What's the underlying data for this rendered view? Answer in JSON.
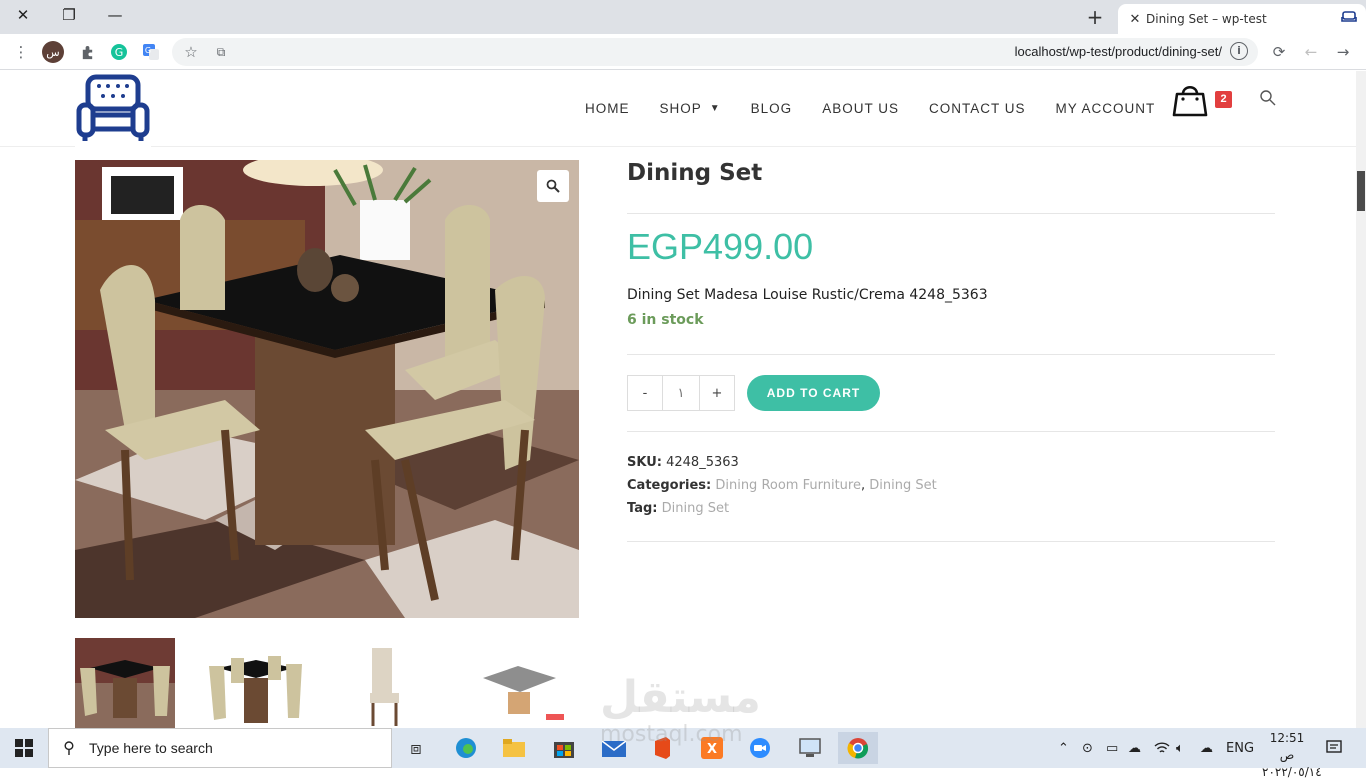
{
  "browser": {
    "tab_title": "Dining Set – wp-test",
    "url": "localhost/wp-test/product/dining-set/",
    "profile_initial": "س"
  },
  "site": {
    "nav": [
      "HOME",
      "SHOP",
      "BLOG",
      "ABOUT US",
      "CONTACT US",
      "MY ACCOUNT"
    ],
    "cart_count": "2",
    "accent": "#3ebfa5",
    "badge_color": "#e23f3f"
  },
  "product": {
    "title": "Dining Set",
    "price": "EGP499.00",
    "description": "Dining Set Madesa Louise Rustic/Crema 4248_5363",
    "stock": "6 in stock",
    "qty_minus": "-",
    "qty_value": "١",
    "qty_plus": "+",
    "add_to_cart": "ADD TO CART",
    "sku_label": "SKU:",
    "sku": "4248_5363",
    "categories_label": "Categories:",
    "categories": [
      "Dining Room Furniture",
      "Dining Set"
    ],
    "tag_label": "Tag:",
    "tag": "Dining Set"
  },
  "watermark": {
    "arabic": "مستقل",
    "latin": "mostaql.com"
  },
  "taskbar": {
    "search_placeholder": "Type here to search",
    "language": "ENG",
    "time": "12:51 ص",
    "date": "٢٠٢٢/٠٥/١٤"
  }
}
